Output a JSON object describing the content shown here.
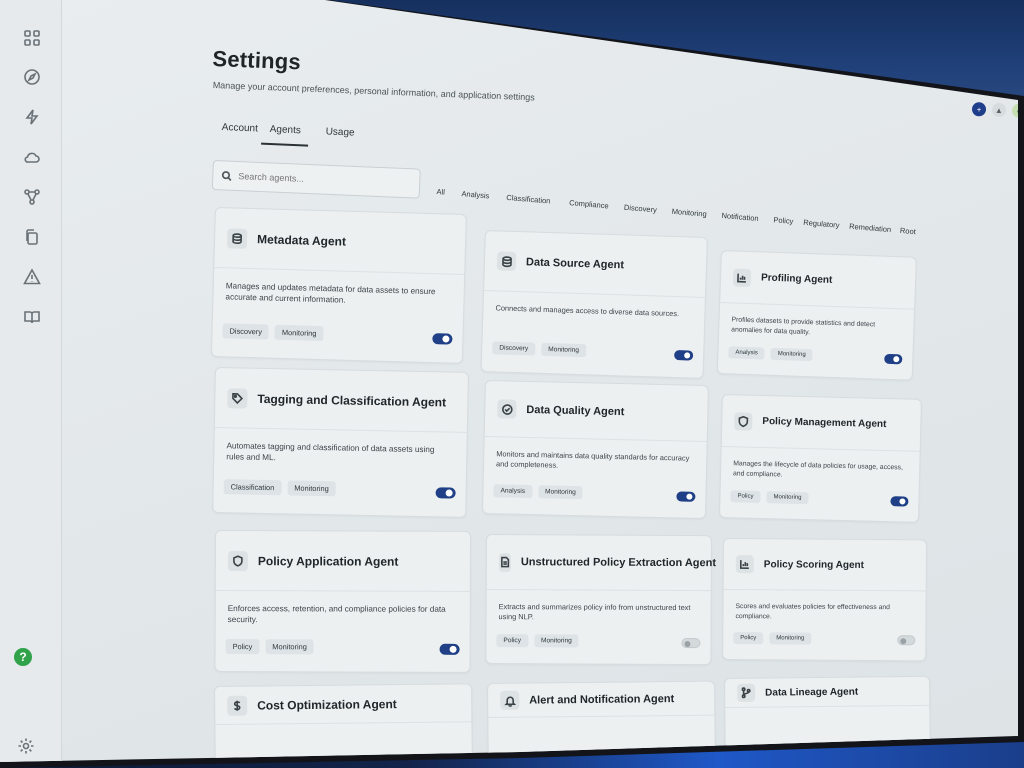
{
  "header": {
    "title": "Settings",
    "subtitle": "Manage your account preferences, personal information, and application settings"
  },
  "tabs": [
    {
      "label": "Account"
    },
    {
      "label": "Agents",
      "active": true
    },
    {
      "label": "Usage"
    }
  ],
  "search": {
    "placeholder": "Search agents..."
  },
  "filters": [
    "All",
    "Analysis",
    "Classification",
    "Compliance",
    "Discovery",
    "Monitoring",
    "Notification",
    "Policy",
    "Regulatory",
    "Remediation",
    "Root"
  ],
  "agents": [
    {
      "title": "Metadata Agent",
      "icon": "database-icon",
      "description": "Manages and updates metadata for data assets to ensure accurate and current information.",
      "tags": [
        "Discovery",
        "Monitoring"
      ],
      "enabled": true
    },
    {
      "title": "Data Source Agent",
      "icon": "database-icon",
      "description": "Connects and manages access to diverse data sources.",
      "tags": [
        "Discovery",
        "Monitoring"
      ],
      "enabled": true
    },
    {
      "title": "Profiling Agent",
      "icon": "chart-icon",
      "description": "Profiles datasets to provide statistics and detect anomalies for data quality.",
      "tags": [
        "Analysis",
        "Monitoring"
      ],
      "enabled": true
    },
    {
      "title": "Tagging and Classification Agent",
      "icon": "tag-icon",
      "description": "Automates tagging and classification of data assets using rules and ML.",
      "tags": [
        "Classification",
        "Monitoring"
      ],
      "enabled": true
    },
    {
      "title": "Data Quality Agent",
      "icon": "check-circle-icon",
      "description": "Monitors and maintains data quality standards for accuracy and completeness.",
      "tags": [
        "Analysis",
        "Monitoring"
      ],
      "enabled": true
    },
    {
      "title": "Policy Management Agent",
      "icon": "shield-icon",
      "description": "Manages the lifecycle of data policies for usage, access, and compliance.",
      "tags": [
        "Policy",
        "Monitoring"
      ],
      "enabled": true
    },
    {
      "title": "Policy Application Agent",
      "icon": "shield-icon",
      "description": "Enforces access, retention, and compliance policies for data security.",
      "tags": [
        "Policy",
        "Monitoring"
      ],
      "enabled": true
    },
    {
      "title": "Unstructured Policy Extraction Agent",
      "icon": "document-icon",
      "description": "Extracts and summarizes policy info from unstructured text using NLP.",
      "tags": [
        "Policy",
        "Monitoring"
      ],
      "enabled": false
    },
    {
      "title": "Policy Scoring Agent",
      "icon": "chart-icon",
      "description": "Scores and evaluates policies for effectiveness and compliance.",
      "tags": [
        "Policy",
        "Monitoring"
      ],
      "enabled": false
    },
    {
      "title": "Cost Optimization Agent",
      "icon": "dollar-icon",
      "description": "",
      "tags": [],
      "enabled": null
    },
    {
      "title": "Alert and Notification Agent",
      "icon": "bell-icon",
      "description": "",
      "tags": [],
      "enabled": null
    },
    {
      "title": "Data Lineage Agent",
      "icon": "branch-icon",
      "description": "",
      "tags": [],
      "enabled": null
    }
  ],
  "colors": {
    "accent": "#1f3f86",
    "help": "#2fa24a"
  }
}
